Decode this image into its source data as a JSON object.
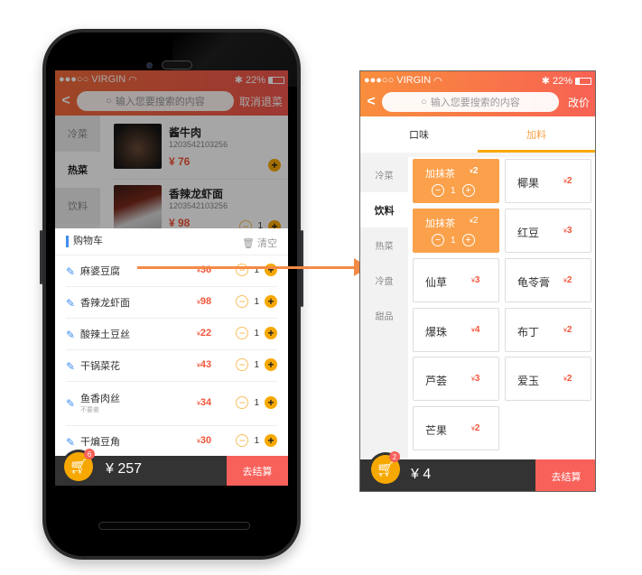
{
  "status_bar": {
    "carrier": "●●●○○ VIRGIN",
    "battery": "22%"
  },
  "left_screen": {
    "header": {
      "back_label": "<",
      "search_placeholder": "输入您要搜索的内容",
      "action_label": "取消退菜"
    },
    "categories": [
      {
        "label": "冷菜"
      },
      {
        "label": "热菜",
        "active": true
      },
      {
        "label": "饮料"
      }
    ],
    "dishes": [
      {
        "name": "酱牛肉",
        "code": "1203542103256",
        "price": "¥ 76"
      },
      {
        "name": "香辣龙虾面",
        "code": "1203542103256",
        "price": "¥ 98",
        "qty": "1"
      }
    ],
    "cart": {
      "title": "购物车",
      "clear_label": "清空",
      "items": [
        {
          "name": "麻婆豆腐",
          "currency": "¥",
          "price": "36",
          "qty": "1",
          "note": ""
        },
        {
          "name": "香辣龙虾面",
          "currency": "¥",
          "price": "98",
          "qty": "1",
          "note": ""
        },
        {
          "name": "酸辣土豆丝",
          "currency": "¥",
          "price": "22",
          "qty": "1",
          "note": ""
        },
        {
          "name": "干锅菜花",
          "currency": "¥",
          "price": "43",
          "qty": "1",
          "note": ""
        },
        {
          "name": "鱼香肉丝",
          "currency": "¥",
          "price": "34",
          "qty": "1",
          "note": "不要姜"
        },
        {
          "name": "干煸豆角",
          "currency": "¥",
          "price": "30",
          "qty": "1",
          "note": ""
        }
      ]
    },
    "bottom": {
      "badge": "6",
      "total": "¥ 257",
      "checkout_label": "去结算"
    }
  },
  "right_screen": {
    "header": {
      "back_label": "<",
      "search_placeholder": "输入您要搜索的内容",
      "action_label": "改价"
    },
    "tabs": [
      {
        "label": "口味"
      },
      {
        "label": "加料",
        "active": true
      }
    ],
    "categories": [
      {
        "label": "冷菜"
      },
      {
        "label": "饮料",
        "active": true
      },
      {
        "label": "热菜"
      },
      {
        "label": "冷盘"
      },
      {
        "label": "甜品"
      }
    ],
    "toppings": [
      {
        "name": "加抹茶",
        "currency": "¥",
        "price": "2",
        "selected": true,
        "qty": "1"
      },
      {
        "name": "椰果",
        "currency": "¥",
        "price": "2"
      },
      {
        "name": "加抹茶",
        "currency": "¥",
        "price": "2",
        "selected": true,
        "qty": "1"
      },
      {
        "name": "红豆",
        "currency": "¥",
        "price": "3"
      },
      {
        "name": "仙草",
        "currency": "¥",
        "price": "3"
      },
      {
        "name": "龟苓膏",
        "currency": "¥",
        "price": "2"
      },
      {
        "name": "爆珠",
        "currency": "¥",
        "price": "4"
      },
      {
        "name": "布丁",
        "currency": "¥",
        "price": "2"
      },
      {
        "name": "芦荟",
        "currency": "¥",
        "price": "3"
      },
      {
        "name": "爱玉",
        "currency": "¥",
        "price": "2"
      },
      {
        "name": "芒果",
        "currency": "¥",
        "price": "2"
      }
    ],
    "bottom": {
      "badge": "2",
      "total": "¥ 4",
      "checkout_label": "去结算"
    }
  },
  "colors": {
    "accent_orange": "#f7a800",
    "price_red": "#f2553a",
    "checkout_red": "#f8605a",
    "link_blue": "#3f8df0"
  }
}
